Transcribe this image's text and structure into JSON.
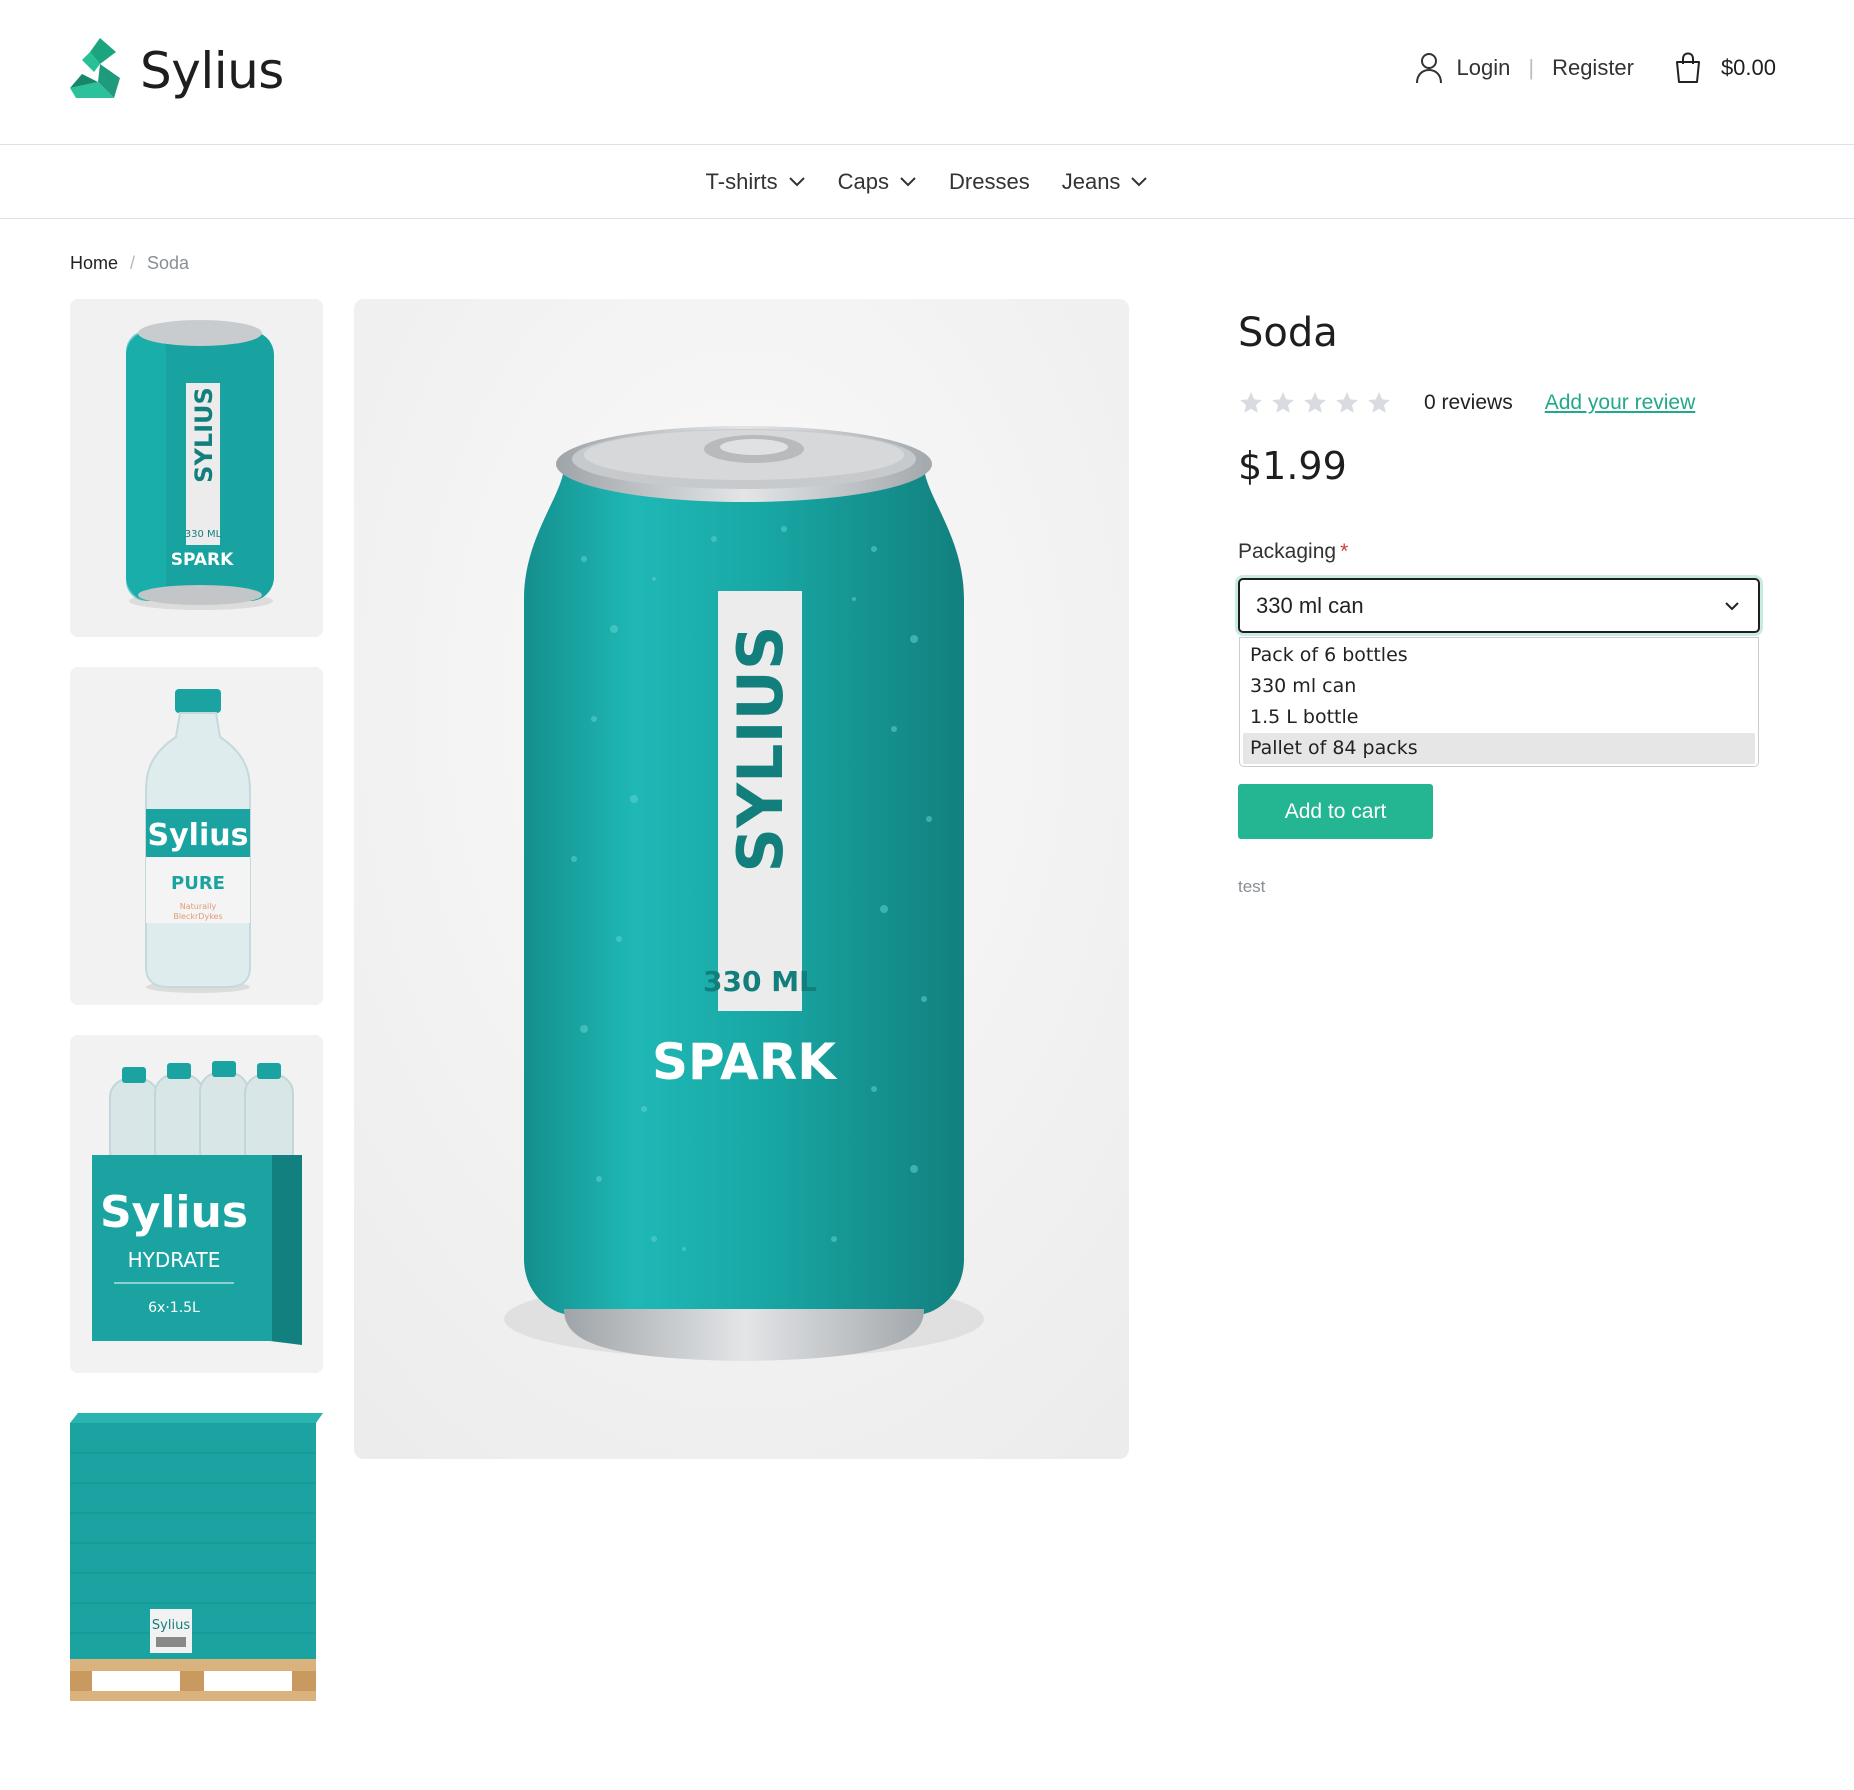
{
  "brand": {
    "name": "Sylius",
    "accent": "#24b592"
  },
  "header": {
    "login_label": "Login",
    "separator": "|",
    "register_label": "Register",
    "cart_total": "$0.00"
  },
  "nav": {
    "items": [
      {
        "label": "T-shirts",
        "has_dropdown": true
      },
      {
        "label": "Caps",
        "has_dropdown": true
      },
      {
        "label": "Dresses",
        "has_dropdown": false
      },
      {
        "label": "Jeans",
        "has_dropdown": true
      }
    ]
  },
  "breadcrumb": {
    "home": "Home",
    "separator": "/",
    "current": "Soda"
  },
  "product": {
    "title": "Soda",
    "rating": 0,
    "reviews_label": "0 reviews",
    "add_review_label": "Add your review",
    "price": "$1.99",
    "description": "test",
    "add_to_cart_label": "Add to cart"
  },
  "packaging": {
    "label": "Packaging",
    "required_mark": "*",
    "selected": "330 ml can",
    "options": [
      "Pack of 6 bottles",
      "330 ml can",
      "1.5 L bottle",
      "Pallet of 84 packs"
    ],
    "hovered_option": "Pallet of 84 packs"
  },
  "images": {
    "thumbnails": [
      {
        "name": "can-thumbnail",
        "texts": [
          "SYLIUS",
          "330 ML",
          "SPARK"
        ]
      },
      {
        "name": "bottle-thumbnail",
        "texts": [
          "Sylius",
          "PURE",
          "Naturally",
          "BleckrDykes"
        ]
      },
      {
        "name": "six-pack-thumbnail",
        "texts": [
          "Sylius",
          "HYDRATE",
          "6x·1.5L"
        ]
      },
      {
        "name": "pallet-thumbnail",
        "texts": [
          "Sylius"
        ]
      }
    ],
    "main": {
      "name": "can-main-image",
      "texts": [
        "SYLIUS",
        "330 ML",
        "SPARK"
      ]
    }
  }
}
